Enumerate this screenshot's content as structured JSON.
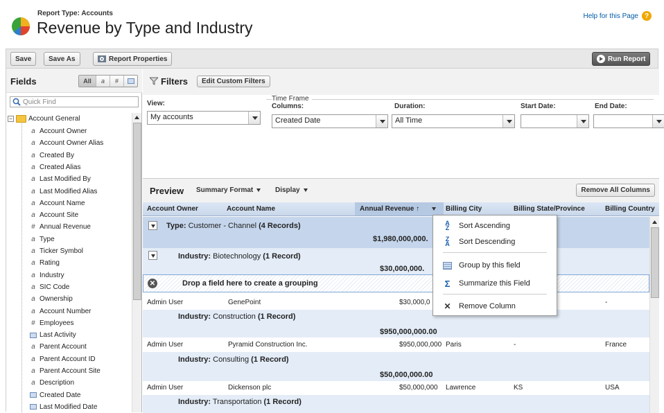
{
  "header": {
    "report_type": "Report Type: Accounts",
    "title": "Revenue by Type and Industry",
    "help_link": "Help for this Page"
  },
  "toolbar": {
    "save": "Save",
    "save_as": "Save As",
    "report_properties": "Report Properties",
    "run_report": "Run Report"
  },
  "fields_panel": {
    "title": "Fields",
    "tab_all": "All",
    "tab_text": "a",
    "tab_num": "#",
    "quick_find_placeholder": "Quick Find",
    "folder": "Account General",
    "items": [
      {
        "label": "Account Owner",
        "type": "text"
      },
      {
        "label": "Account Owner Alias",
        "type": "text"
      },
      {
        "label": "Created By",
        "type": "text"
      },
      {
        "label": "Created Alias",
        "type": "text"
      },
      {
        "label": "Last Modified By",
        "type": "text"
      },
      {
        "label": "Last Modified Alias",
        "type": "text"
      },
      {
        "label": "Account Name",
        "type": "text"
      },
      {
        "label": "Account Site",
        "type": "text"
      },
      {
        "label": "Annual Revenue",
        "type": "number"
      },
      {
        "label": "Type",
        "type": "text"
      },
      {
        "label": "Ticker Symbol",
        "type": "text"
      },
      {
        "label": "Rating",
        "type": "text"
      },
      {
        "label": "Industry",
        "type": "text"
      },
      {
        "label": "SIC Code",
        "type": "text"
      },
      {
        "label": "Ownership",
        "type": "text"
      },
      {
        "label": "Account Number",
        "type": "text"
      },
      {
        "label": "Employees",
        "type": "number"
      },
      {
        "label": "Last Activity",
        "type": "date"
      },
      {
        "label": "Parent Account",
        "type": "text"
      },
      {
        "label": "Parent Account ID",
        "type": "text"
      },
      {
        "label": "Parent Account Site",
        "type": "text"
      },
      {
        "label": "Description",
        "type": "text"
      },
      {
        "label": "Created Date",
        "type": "date"
      },
      {
        "label": "Last Modified Date",
        "type": "date"
      }
    ]
  },
  "filters": {
    "title": "Filters",
    "edit_custom": "Edit Custom Filters",
    "view_label": "View:",
    "view_value": "My accounts",
    "time_frame": "Time Frame",
    "columns_label": "Columns:",
    "columns_value": "Created Date",
    "duration_label": "Duration:",
    "duration_value": "All Time",
    "start_label": "Start Date:",
    "start_value": "",
    "end_label": "End Date:",
    "end_value": ""
  },
  "preview": {
    "title": "Preview",
    "summary_format": "Summary Format",
    "display": "Display",
    "remove_all": "Remove All Columns",
    "columns": [
      "Account Owner",
      "Account Name",
      "Annual Revenue",
      "Billing City",
      "Billing State/Province",
      "Billing Country"
    ],
    "sort_arrow": "↑",
    "type_group": {
      "label": "Type:",
      "value": "Customer - Channel",
      "count": "(4 Records)",
      "total": "$1,980,000,000."
    },
    "drop_zone": "Drop a field here to create a grouping",
    "industries": [
      {
        "label": "Industry:",
        "value": "Biotechnology",
        "count": "(1 Record)",
        "total": "$30,000,000.",
        "row": {
          "owner": "Admin User",
          "name": "GenePoint",
          "revenue": "$30,000,0",
          "city": "",
          "state": "",
          "country": "-"
        }
      },
      {
        "label": "Industry:",
        "value": "Construction",
        "count": "(1 Record)",
        "total": "$950,000,000.00",
        "row": {
          "owner": "Admin User",
          "name": "Pyramid Construction Inc.",
          "revenue": "$950,000,000",
          "city": "Paris",
          "state": "-",
          "country": "France"
        }
      },
      {
        "label": "Industry:",
        "value": "Consulting",
        "count": "(1 Record)",
        "total": "$50,000,000.00",
        "row": {
          "owner": "Admin User",
          "name": "Dickenson plc",
          "revenue": "$50,000,000",
          "city": "Lawrence",
          "state": "KS",
          "country": "USA"
        }
      },
      {
        "label": "Industry:",
        "value": "Transportation",
        "count": "(1 Record)"
      }
    ]
  },
  "context_menu": {
    "sort_ascending": "Sort Ascending",
    "sort_descending": "Sort Descending",
    "group_by": "Group by this field",
    "summarize": "Summarize this Field",
    "remove_column": "Remove Column"
  }
}
